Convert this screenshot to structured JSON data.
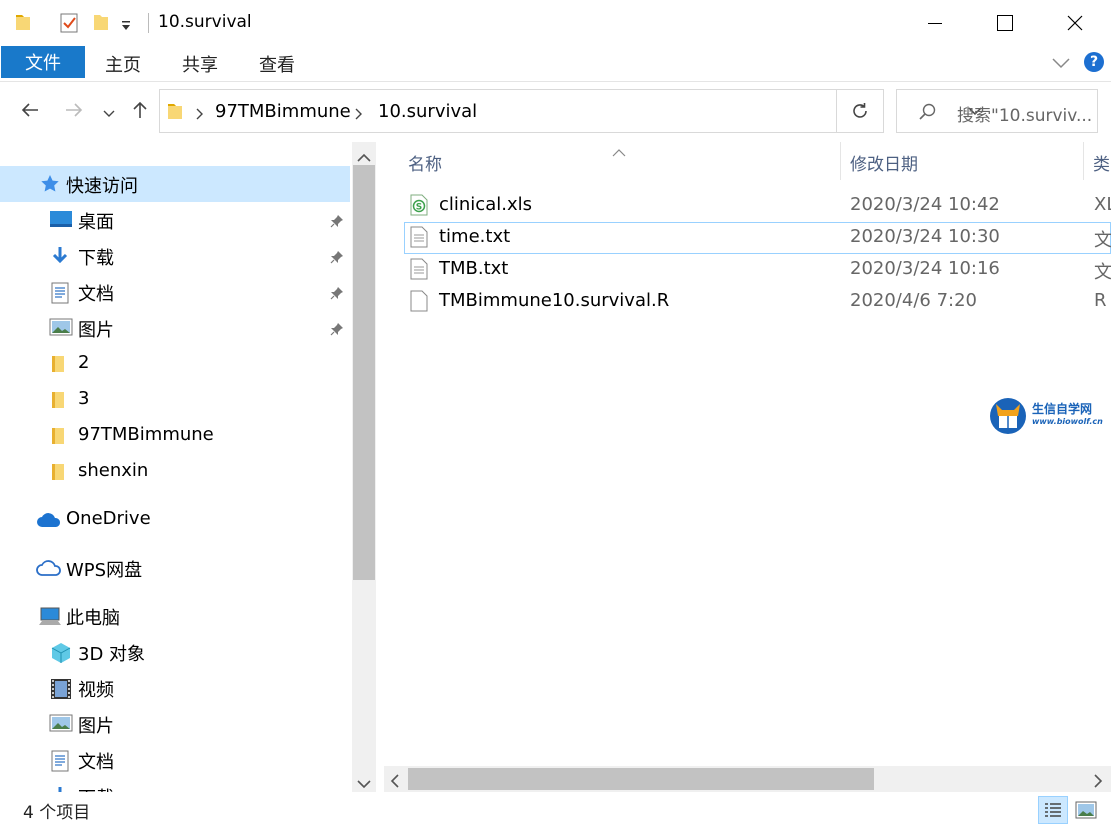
{
  "window": {
    "title": "10.survival"
  },
  "ribbon": {
    "tabs": [
      "文件",
      "主页",
      "共享",
      "查看"
    ],
    "help": "?"
  },
  "address": {
    "crumbs": [
      "97TMBimmune",
      "10.survival"
    ],
    "search_placeholder": "搜索\"10.surviv..."
  },
  "sidebar": {
    "quick_access": "快速访问",
    "pinned": [
      {
        "label": "桌面",
        "icon": "desktop-icon"
      },
      {
        "label": "下载",
        "icon": "download-icon"
      },
      {
        "label": "文档",
        "icon": "documents-icon"
      },
      {
        "label": "图片",
        "icon": "pictures-icon"
      }
    ],
    "folders": [
      "2",
      "3",
      "97TMBimmune",
      "shenxin"
    ],
    "onedrive": "OneDrive",
    "wps": "WPS网盘",
    "this_pc": "此电脑",
    "pc_items": [
      {
        "label": "3D 对象",
        "icon": "3d-objects-icon"
      },
      {
        "label": "视频",
        "icon": "videos-icon"
      },
      {
        "label": "图片",
        "icon": "pictures-icon"
      },
      {
        "label": "文档",
        "icon": "documents-icon"
      },
      {
        "label": "下载",
        "icon": "download-icon"
      }
    ]
  },
  "columns": {
    "name": "名称",
    "date": "修改日期",
    "type": "类"
  },
  "files": [
    {
      "name": "clinical.xls",
      "date": "2020/3/24 10:42",
      "type": "XL",
      "icon": "spreadsheet-icon"
    },
    {
      "name": "time.txt",
      "date": "2020/3/24 10:30",
      "type": "文",
      "icon": "text-file-icon"
    },
    {
      "name": "TMB.txt",
      "date": "2020/3/24 10:16",
      "type": "文",
      "icon": "text-file-icon"
    },
    {
      "name": "TMBimmune10.survival.R",
      "date": "2020/4/6 7:20",
      "type": "R",
      "icon": "file-icon"
    }
  ],
  "status": {
    "count": "4 个项目"
  },
  "watermark": {
    "line1": "生信自学网",
    "line2": "www.biowolf.cn"
  },
  "colors": {
    "accent": "#1979ca",
    "selection": "#cce8ff",
    "focus_border": "#99d1ff"
  }
}
